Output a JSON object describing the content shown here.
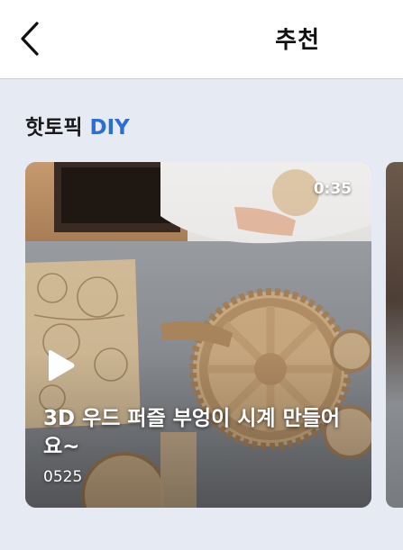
{
  "header": {
    "back_icon": "chevron-left-icon",
    "title": "추천"
  },
  "section": {
    "label": "핫토픽",
    "highlight": "DIY",
    "highlight_color": "#2d6fcf"
  },
  "videos": [
    {
      "duration": "0:35",
      "title": "3D 우드 퍼즐 부엉이 시계 만들어요~",
      "meta": "0525",
      "play_icon": "play-icon"
    }
  ]
}
